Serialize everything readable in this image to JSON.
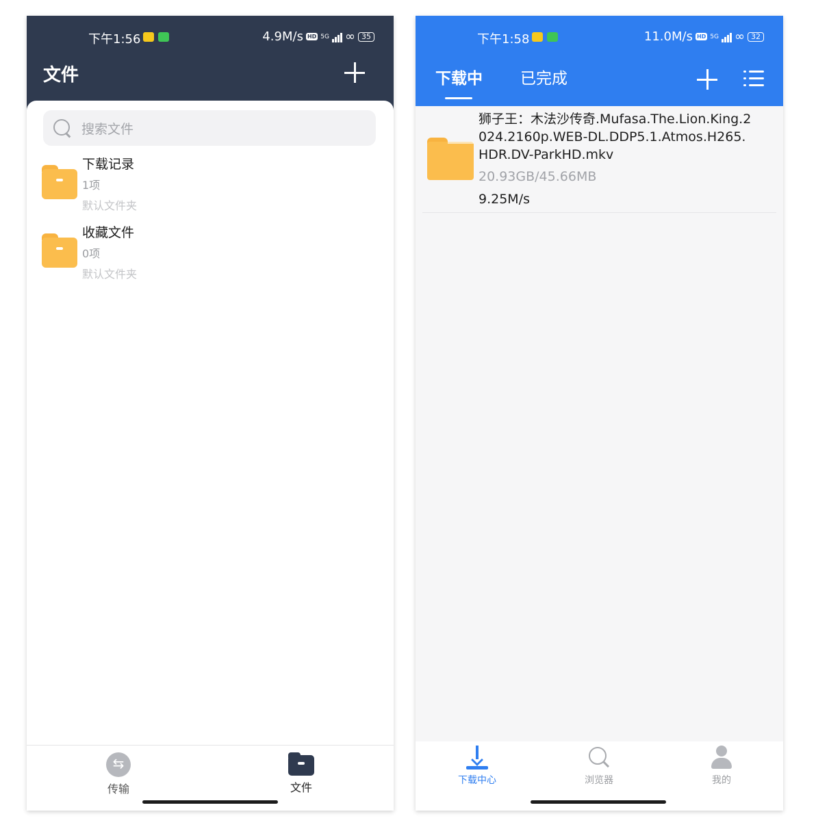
{
  "left": {
    "status": {
      "time": "下午1:56",
      "speed": "4.9M/s",
      "network": "5G",
      "hd": "HD",
      "battery": "35"
    },
    "header": {
      "title": "文件"
    },
    "search": {
      "placeholder": "搜索文件"
    },
    "folders": [
      {
        "name": "下载记录",
        "count": "1项",
        "subtitle": "默认文件夹"
      },
      {
        "name": "收藏文件",
        "count": "0项",
        "subtitle": "默认文件夹"
      }
    ],
    "nav": [
      {
        "label": "传输",
        "icon": "transfer-icon"
      },
      {
        "label": "文件",
        "icon": "folder-icon"
      }
    ]
  },
  "right": {
    "status": {
      "time": "下午1:58",
      "speed": "11.0M/s",
      "network": "5G",
      "hd": "HD",
      "battery": "32"
    },
    "tabs": [
      {
        "label": "下载中",
        "active": true
      },
      {
        "label": "已完成",
        "active": false
      }
    ],
    "downloads": [
      {
        "name": "狮子王：木法沙传奇.Mufasa.The.Lion.King.2024.2160p.WEB-DL.DDP5.1.Atmos.H265.HDR.DV-ParkHD.mkv",
        "progress": "20.93GB/45.66MB",
        "speed": "9.25M/s"
      }
    ],
    "nav": [
      {
        "label": "下载中心",
        "icon": "download-icon",
        "active": true
      },
      {
        "label": "浏览器",
        "icon": "search-icon",
        "active": false
      },
      {
        "label": "我的",
        "icon": "user-icon",
        "active": false
      }
    ]
  },
  "colors": {
    "left_header": "#2f3a4f",
    "right_header": "#2f7ef0",
    "folder": "#fbbd4d"
  }
}
